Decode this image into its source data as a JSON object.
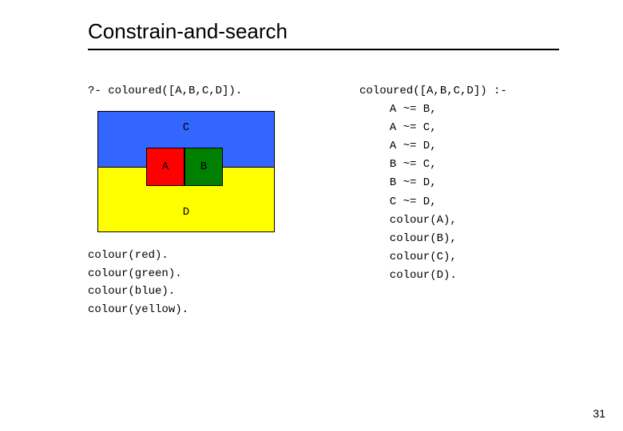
{
  "title": "Constrain-and-search",
  "left": {
    "query": "?- coloured([A,B,C,D]).",
    "diagram": {
      "A": "A",
      "B": "B",
      "C": "C",
      "D": "D"
    },
    "facts": [
      "colour(red).",
      "colour(green).",
      "colour(blue).",
      "colour(yellow)."
    ]
  },
  "right": {
    "head": "coloured([A,B,C,D]) :-",
    "body": [
      "A ~= B,",
      "A ~= C,",
      "A ~= D,",
      "B ~= C,",
      "B ~= D,",
      "C ~= D,",
      "colour(A),",
      "colour(B),",
      "colour(C),",
      "colour(D)."
    ]
  },
  "page": "31"
}
